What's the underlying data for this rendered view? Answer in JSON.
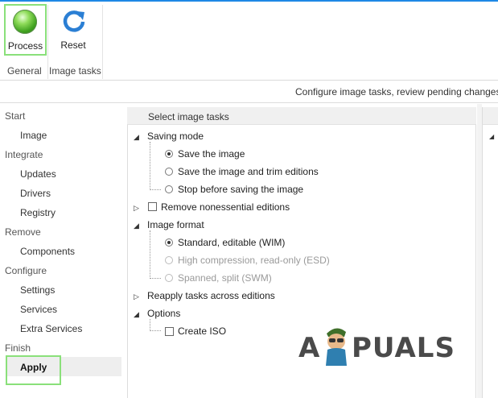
{
  "colors": {
    "accent_topline": "#1e88e5",
    "highlight_border": "#8ae07a",
    "orb_green": "#3fa11f",
    "reset_blue": "#2b7fd4"
  },
  "ribbon": {
    "process_label": "Process",
    "process_icon": "process-orb-icon",
    "reset_label": "Reset",
    "reset_icon": "refresh-icon",
    "group_general": "General",
    "group_image_tasks": "Image tasks"
  },
  "status_line": "Configure image tasks, review pending changes",
  "nav": {
    "start": "Start",
    "image": "Image",
    "integrate": "Integrate",
    "updates": "Updates",
    "drivers": "Drivers",
    "registry": "Registry",
    "remove": "Remove",
    "components": "Components",
    "configure": "Configure",
    "settings": "Settings",
    "services": "Services",
    "extra_services": "Extra Services",
    "finish": "Finish",
    "apply": "Apply"
  },
  "panel": {
    "header": "Select image tasks",
    "saving_mode": "Saving mode",
    "save_image": "Save the image",
    "save_trim": "Save the image and trim editions",
    "stop_before": "Stop before saving the image",
    "remove_nonessential": "Remove nonessential editions",
    "image_format": "Image format",
    "standard_wim": "Standard, editable (WIM)",
    "high_esd": "High compression, read-only (ESD)",
    "spanned_swm": "Spanned, split (SWM)",
    "reapply": "Reapply tasks across editions",
    "options": "Options",
    "create_iso": "Create ISO"
  },
  "watermark": {
    "text_a": "A",
    "text_rest": "PUALS"
  }
}
